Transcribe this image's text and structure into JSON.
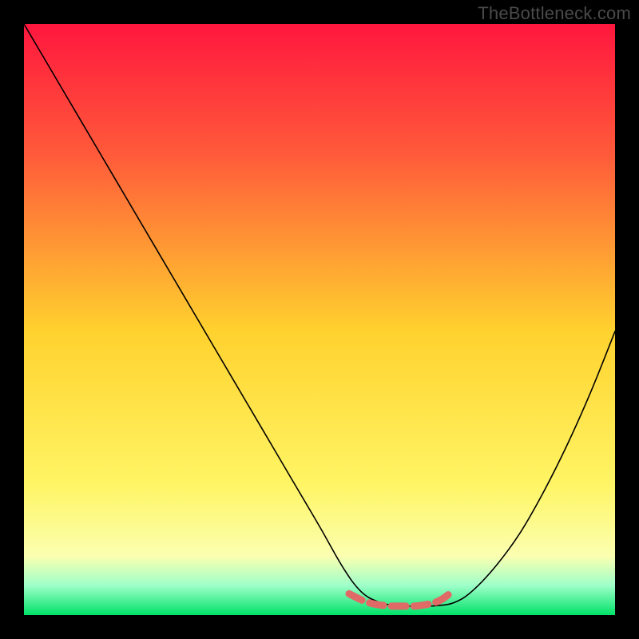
{
  "watermark": "TheBottleneck.com",
  "chart_data": {
    "type": "line",
    "title": "",
    "xlabel": "",
    "ylabel": "",
    "xlim": [
      0,
      100
    ],
    "ylim": [
      0,
      100
    ],
    "background_gradient": {
      "top": "#ff173e",
      "mid_upper": "#ff5a3a",
      "mid": "#ffd22e",
      "mid_lower": "#fff565",
      "low": "#fbffb0",
      "bottom_band": "#9effc9",
      "bottom": "#00e268"
    },
    "curve": {
      "name": "bottleneck-curve",
      "x": [
        0,
        5,
        10,
        15,
        20,
        25,
        30,
        35,
        40,
        45,
        50,
        54,
        57,
        60,
        63,
        66,
        70,
        73,
        76,
        80,
        84,
        88,
        92,
        96,
        100
      ],
      "y": [
        100,
        91.5,
        83,
        74.5,
        66,
        57.5,
        49,
        40.5,
        32,
        23.5,
        15,
        8,
        4,
        2.2,
        1.6,
        1.5,
        1.6,
        2.2,
        4.2,
        8.5,
        14,
        21,
        29,
        38,
        48
      ]
    },
    "flat_zone_marker": {
      "note": "dashed salmon segment along curve bottom",
      "x": [
        55,
        58,
        61,
        64,
        67,
        70,
        72
      ],
      "y": [
        3.6,
        2.2,
        1.6,
        1.5,
        1.6,
        2.3,
        3.6
      ],
      "color": "#e06a66",
      "dash": [
        18,
        10
      ],
      "width": 9
    }
  }
}
